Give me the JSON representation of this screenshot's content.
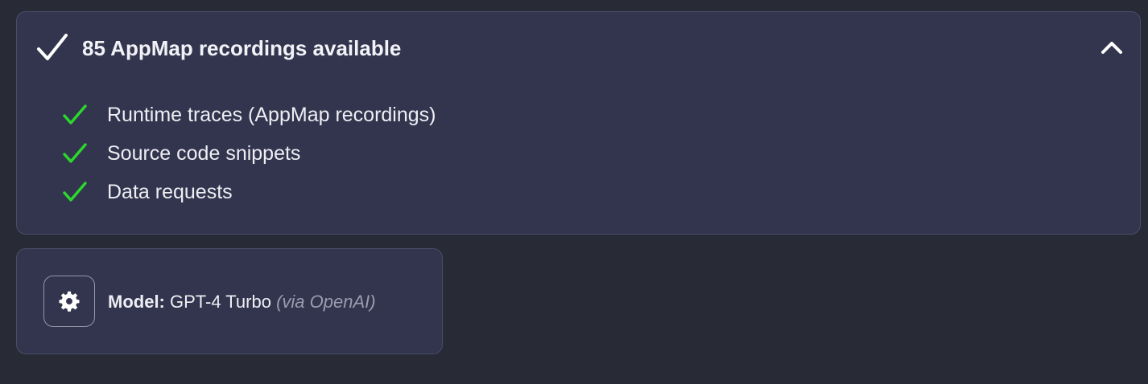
{
  "status_panel": {
    "title": "85 AppMap recordings available",
    "header_icon": "check-icon",
    "toggle_icon": "chevron-up-icon",
    "features": [
      {
        "label": "Runtime traces (AppMap recordings)",
        "icon": "check-icon"
      },
      {
        "label": "Source code snippets",
        "icon": "check-icon"
      },
      {
        "label": "Data requests",
        "icon": "check-icon"
      }
    ]
  },
  "model_card": {
    "settings_icon": "gear-icon",
    "label": "Model:",
    "model_name": "GPT-4 Turbo",
    "provider": "(via OpenAI)"
  },
  "colors": {
    "background": "#282a36",
    "panel": "#33354f",
    "border": "#4a4d66",
    "check_green": "#2bd92b",
    "text": "#eeeef3",
    "muted": "#9a9cae"
  }
}
